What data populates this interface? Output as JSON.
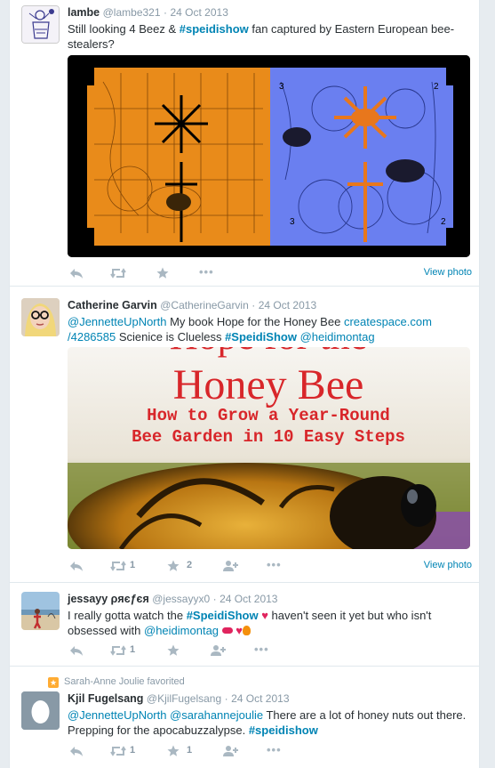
{
  "tweets": [
    {
      "name": "lambe",
      "username": "@lambe321",
      "sep": "·",
      "time": "24 Oct 2013",
      "text_a": "Still looking 4 Beez & ",
      "text_hashtag": "#speidishow",
      "text_b": " fan captured by Eastern European bee-stealers?",
      "view_photo": "View photo",
      "retweets": "",
      "favorites": ""
    },
    {
      "name": "Catherine Garvin",
      "username": "@CatherineGarvin",
      "sep": "·",
      "time": "24 Oct 2013",
      "mention": "@JennetteUpNorth",
      "text_a": " My book Hope for the Honey Bee ",
      "link_a": "createspace.com",
      "link_b": "/4286585",
      "text_b": " Scienice is Clueless ",
      "hashtag": "#SpeidiShow",
      "mention2": "@heidimontag",
      "book_title_top": "Hope for the",
      "book_title": "Honey Bee",
      "book_sub1": "How to Grow a Year-Round",
      "book_sub2": "Bee Garden in 10 Easy Steps",
      "view_photo": "View photo",
      "retweets": "1",
      "favorites": "2"
    },
    {
      "name": "jessayy",
      "name_extra": "ρяєƒєя",
      "username": "@jessayyx0",
      "sep": "·",
      "time": "24 Oct 2013",
      "text_a": "I really gotta watch the ",
      "hashtag": "#SpeidiShow",
      "text_b": " haven't seen it yet but who isn't obsessed with ",
      "mention": "@heidimontag",
      "retweets": "1",
      "favorites": ""
    },
    {
      "context": "Sarah-Anne Joulie favorited",
      "name": "Kjil Fugelsang",
      "username": "@KjilFugelsang",
      "sep": "·",
      "time": "24 Oct 2013",
      "mention": "@JennetteUpNorth",
      "mention2": "@sarahannejoulie",
      "text_a": " There are a lot of honey nuts out there. Prepping for the apocabuzzalypse. ",
      "hashtag": "#speidishow",
      "retweets": "1",
      "favorites": "1"
    }
  ],
  "colors": {
    "link": "#0084b4",
    "muted": "#8899a6",
    "action": "#aab8c2",
    "heart": "#e0245e",
    "fav_badge": "#ffac33"
  },
  "icons": [
    "reply-icon",
    "retweet-icon",
    "favorite-star-icon",
    "more-icon",
    "follow-icon",
    "heart-emoji",
    "lips-emoji",
    "fire-emoji",
    "egg-avatar-icon",
    "favorite-badge-icon"
  ]
}
